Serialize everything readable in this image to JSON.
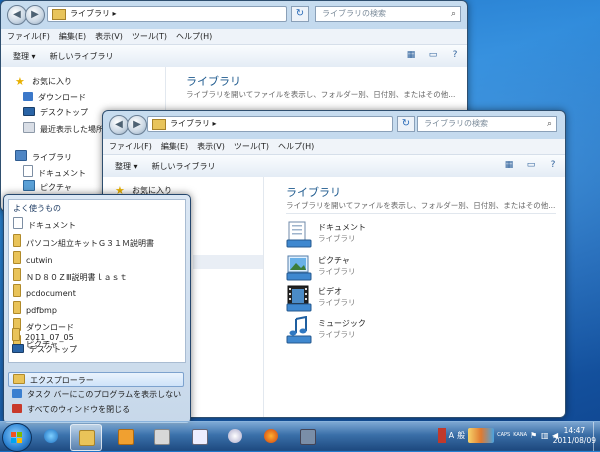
{
  "back_window": {
    "address": "ライブラリ",
    "search_placeholder": "ライブラリの検索",
    "menu": [
      "ファイル(F)",
      "編集(E)",
      "表示(V)",
      "ツール(T)",
      "ヘルプ(H)"
    ],
    "toolbar": [
      "整理 ▾",
      "新しいライブラリ"
    ],
    "nav": [
      "お気に入り",
      "ダウンロード",
      "デスクトップ",
      "最近表示した場所",
      "ライブラリ",
      "ドキュメント",
      "ピクチャ"
    ],
    "title": "ライブラリ",
    "subtitle": "ライブラリを開いてファイルを表示し、フォルダー別、日付別、またはその他..."
  },
  "front_window": {
    "address": "ライブラリ",
    "search_placeholder": "ライブラリの検索",
    "menu": [
      "ファイル(F)",
      "編集(E)",
      "表示(V)",
      "ツール(T)",
      "ヘルプ(H)"
    ],
    "toolbar": [
      "整理 ▾",
      "新しいライブラリ"
    ],
    "nav_partial": "お気に入り",
    "title": "ライブラリ",
    "subtitle": "ライブラリを開いてファイルを表示し、フォルダー別、日付別、またはその他...",
    "libraries": [
      {
        "name": "ドキュメント",
        "type": "ライブラリ"
      },
      {
        "name": "ピクチャ",
        "type": "ライブラリ"
      },
      {
        "name": "ビデオ",
        "type": "ライブラリ"
      },
      {
        "name": "ミュージック",
        "type": "ライブラリ"
      }
    ]
  },
  "jumplist": {
    "heading": "よく使うもの",
    "items": [
      "ドキュメント",
      "パソコン組立キットＧ３１Ｍ説明書",
      "cutwin",
      "ＮＤ８０ＺⅢ説明書ｌａｓｔ",
      "pcdocument",
      "pdfbmp",
      "ダウンロード",
      "ピクチャ",
      "2011_07_05",
      "デスクトップ"
    ],
    "actions": [
      "エクスプローラー",
      "タスク バーにこのプログラムを表示しない",
      "すべてのウィンドウを閉じる"
    ]
  },
  "taskbar": {
    "tray": [
      "A",
      "般",
      "CAPS",
      "KANA"
    ],
    "time": "14:47",
    "date": "2011/08/09"
  }
}
